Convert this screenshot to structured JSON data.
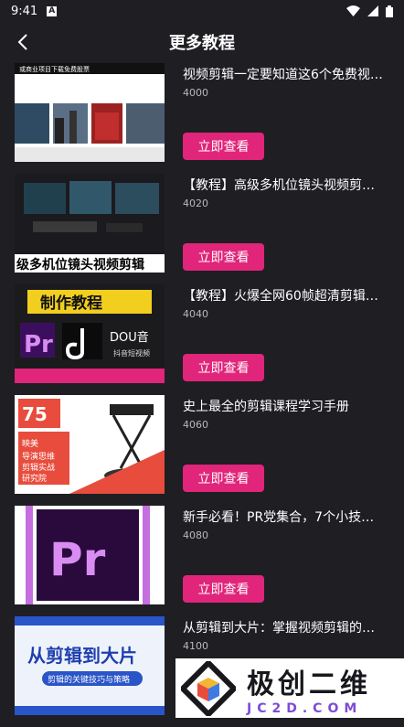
{
  "status": {
    "time": "9:41",
    "notif_icon": "a-notification-icon"
  },
  "header": {
    "title": "更多教程",
    "back_icon": "chevron-left-icon"
  },
  "items": [
    {
      "title": "视频剪辑一定要知道这6个免费视频…",
      "count": "4000",
      "button": "立即查看",
      "thumb_text": "或商业项目下载免费股票"
    },
    {
      "title": "【教程】高级多机位镜头视频剪辑…",
      "count": "4020",
      "button": "立即查看",
      "thumb_text": "级多机位镜头视频剪辑"
    },
    {
      "title": "【教程】火爆全网60帧超清剪辑教…",
      "count": "4040",
      "button": "立即查看",
      "thumb_text": "制作教程",
      "thumb_sub": "DOU音",
      "thumb_sub2": "抖音短视频"
    },
    {
      "title": "史上最全的剪辑课程学习手册",
      "count": "4060",
      "button": "立即查看",
      "thumb_text": "75",
      "thumb_sub": "映美 导演思维 剪辑实战 研究院"
    },
    {
      "title": "新手必看！PR党集合，7个小技巧…",
      "count": "4080",
      "button": "立即查看",
      "thumb_text": "Pr"
    },
    {
      "title": "从剪辑到大片：掌握视频剪辑的关…",
      "count": "4100",
      "button": "立即查看",
      "thumb_text": "从剪辑到大片",
      "thumb_sub": "剪辑的关键技巧与策略"
    }
  ],
  "watermark": {
    "main": "极创二维",
    "sub": "JC2D.COM"
  }
}
